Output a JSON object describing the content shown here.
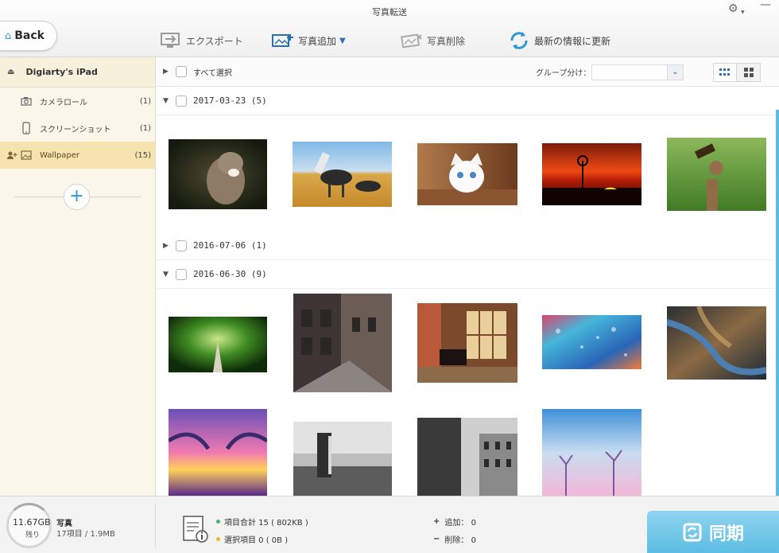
{
  "window": {
    "title": "写真転送"
  },
  "nav": {
    "back_label": "Back"
  },
  "toolbar": {
    "export_label": "エクスポート",
    "add_label": "写真追加",
    "delete_label": "写真削除",
    "refresh_label": "最新の情報に更新"
  },
  "sidebar": {
    "device_name": "Digiarty's iPad",
    "items": [
      {
        "label": "カメラロール",
        "count": "(1)"
      },
      {
        "label": "スクリーンショット",
        "count": "(1)"
      },
      {
        "label": "Wallpaper",
        "count": "(15)"
      }
    ]
  },
  "main": {
    "select_all_label": "すべて選択",
    "group_by_label": "グループ分け：",
    "group_by_value": "",
    "groups": [
      {
        "date": "2017-03-23 (5)",
        "expanded": true
      },
      {
        "date": "2016-07-06 (1)",
        "expanded": false
      },
      {
        "date": "2016-06-30 (9)",
        "expanded": true
      }
    ]
  },
  "footer": {
    "free_space": "11.67GB",
    "free_label": "残り",
    "category_name": "写真",
    "category_stats": "17項目 / 1.9MB",
    "total_items": "項目合計 15 ( 802KB )",
    "selected_items": "選択項目 0 ( 0B )",
    "add_count": "追加：  0",
    "delete_count": "削除：  0",
    "sync_label": "同期"
  },
  "colors": {
    "accent": "#2d98d3",
    "sidebar_bg": "#faf6e9",
    "sidebar_active": "#f5e3b0",
    "sync_button": "#5bbde2",
    "total_dot": "#3dbb6a",
    "selected_dot": "#f0b62a"
  }
}
